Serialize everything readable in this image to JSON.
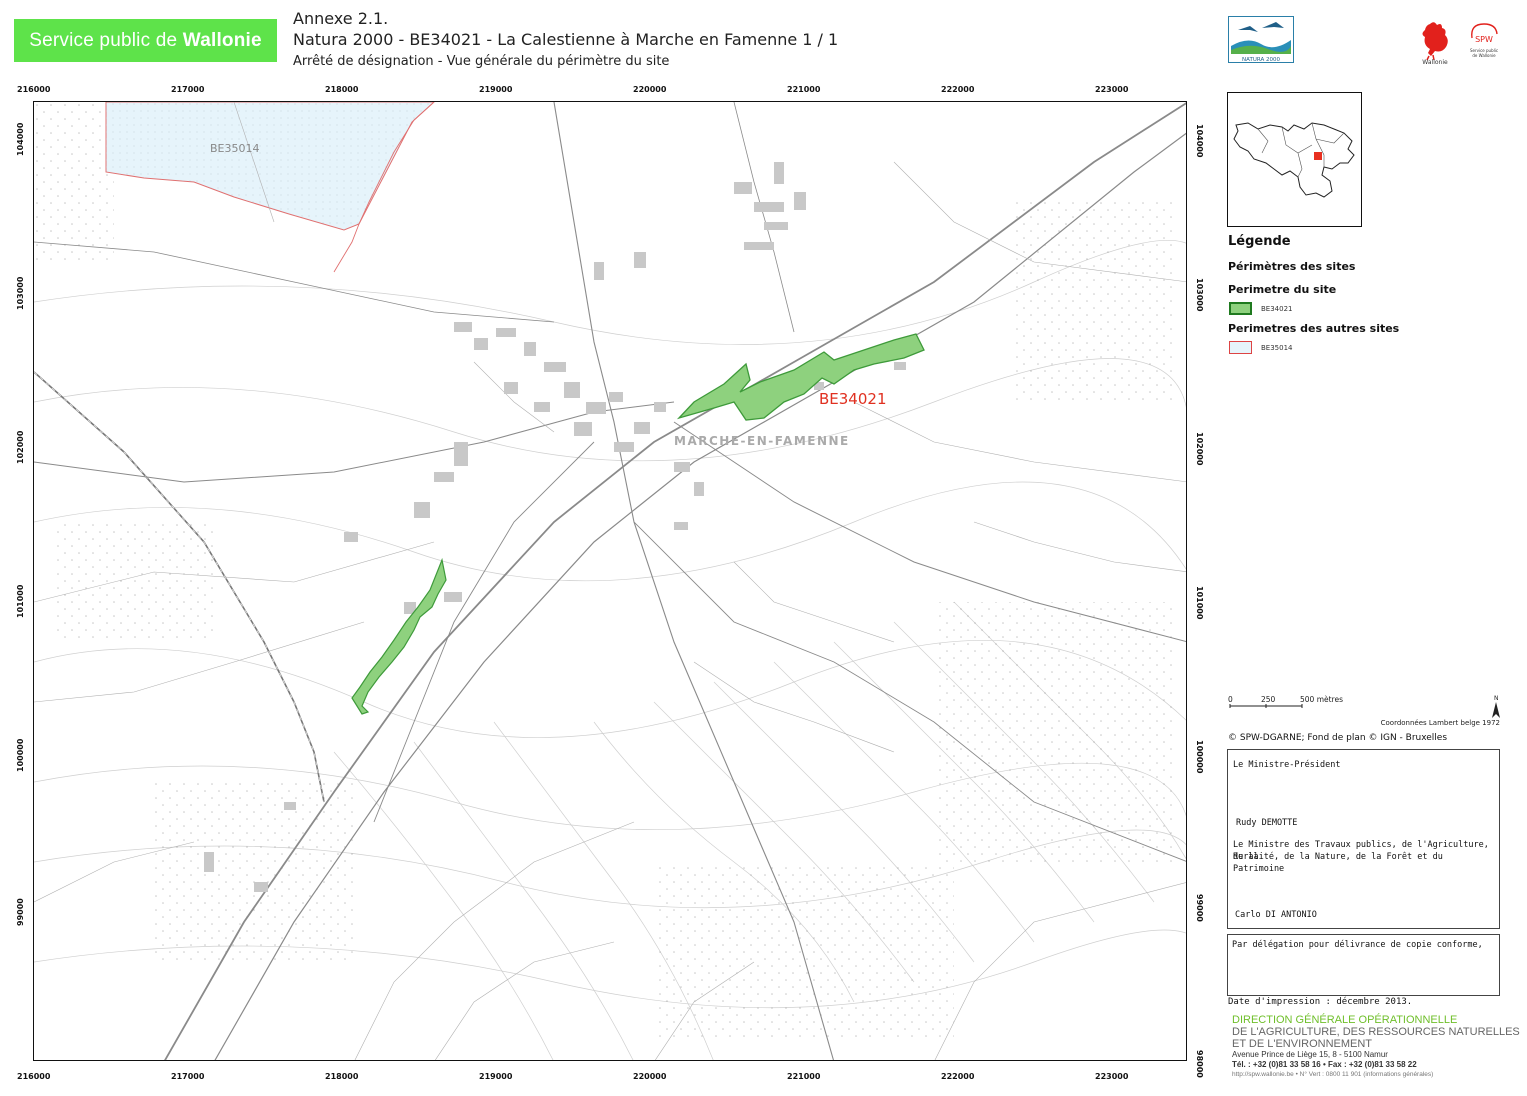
{
  "header": {
    "banner_prefix": "Service public de ",
    "banner_bold": "Wallonie",
    "line1": "Annexe 2.1.",
    "line2": "Natura 2000 - BE34021 - La Calestienne à Marche en Famenne  1 / 1",
    "line3": "Arrêté de désignation - Vue générale du périmètre du site"
  },
  "logos": {
    "natura_text": "NATURA 2000",
    "wallonie_text": "Wallonie",
    "spw_text": "SPW",
    "spw_sub1": "Service public",
    "spw_sub2": "de Wallonie"
  },
  "map": {
    "x_ticks": [
      "216000",
      "217000",
      "218000",
      "219000",
      "220000",
      "221000",
      "222000",
      "223000"
    ],
    "y_ticks": [
      "104000",
      "103000",
      "102000",
      "101000",
      "100000",
      "99000"
    ],
    "y_tick_bottom_right": "98000",
    "site_label": "BE34021",
    "other_site_label": "BE35014",
    "town_label": "MARCHE-EN-FAMENNE",
    "colors": {
      "site_fill": "#8ed17e",
      "site_stroke": "#3e9a3a",
      "other_fill": "#e6f4fb",
      "other_stroke": "#e07070",
      "site_label": "#e03020"
    }
  },
  "legend": {
    "title": "Légende",
    "group_title": "Périmètres des sites",
    "own_site_title": "Perimetre du site",
    "own_site_item": "BE34021",
    "other_sites_title": "Perimetres des autres sites",
    "other_sites_item": "BE35014"
  },
  "scale": {
    "labels": [
      "0",
      "250",
      "500 mètres"
    ],
    "north": "N",
    "coord_note": "Coordonnées Lambert belge 1972"
  },
  "copyright": "© SPW-DGARNE; Fond de plan © IGN - Bruxelles",
  "signatures": {
    "ministre_president": "Le Ministre-Président",
    "name1": "Rudy DEMOTTE",
    "ministre_line1": "Le Ministre des Travaux publics, de l'Agriculture, de la",
    "ministre_line2": "Ruralité, de la Nature, de la Forêt et du Patrimoine",
    "name2": "Carlo DI ANTONIO",
    "delegation": "Par délégation pour délivrance de copie conforme,"
  },
  "print_date": "Date d'impression : décembre 2013.",
  "dgo": {
    "line1": "DIRECTION GÉNÉRALE OPÉRATIONNELLE",
    "line2": "DE L'AGRICULTURE, DES RESSOURCES NATURELLES",
    "line3": "ET DE L'ENVIRONNEMENT",
    "line4": "Avenue Prince de Liège 15, 8 - 5100 Namur",
    "line5": "Tél. : +32 (0)81 33 58 16 • Fax : +32 (0)81 33 58 22",
    "line6": "http://spw.wallonie.be • N° Vert : 0800 11 901 (informations générales)"
  }
}
